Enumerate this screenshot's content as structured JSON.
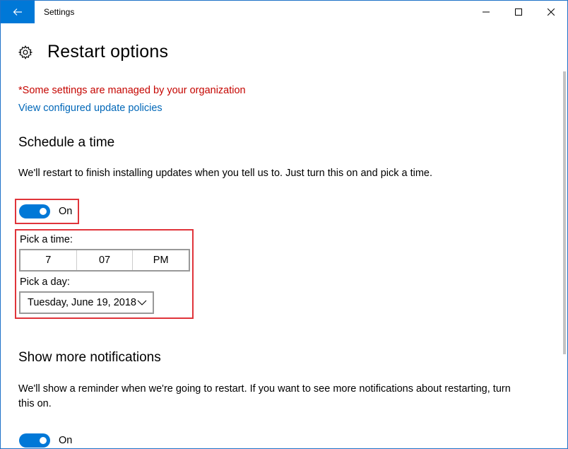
{
  "window": {
    "title": "Settings"
  },
  "page": {
    "title": "Restart options"
  },
  "notice": {
    "managed": "*Some settings are managed by your organization",
    "policies_link": "View configured update policies"
  },
  "schedule": {
    "heading": "Schedule a time",
    "description": "We'll restart to finish installing updates when you tell us to. Just turn this on and pick a time.",
    "toggle_label": "On",
    "toggle_on": true,
    "time_label": "Pick a time:",
    "time": {
      "hour": "7",
      "minute": "07",
      "period": "PM"
    },
    "day_label": "Pick a day:",
    "day_value": "Tuesday, June 19, 2018"
  },
  "notifications": {
    "heading": "Show more notifications",
    "description_line1": "We'll show a reminder when we're going to restart. If you want to see more notifications about restarting, turn",
    "description_line2": "this on.",
    "toggle_label": "On",
    "toggle_on": true
  },
  "colors": {
    "accent": "#0078d7",
    "warning": "#c50500",
    "link": "#0067b8",
    "highlight": "#e0343a"
  },
  "icons": {
    "back": "back-arrow-icon",
    "minimize": "minimize-icon",
    "maximize": "maximize-icon",
    "close": "close-icon",
    "gear": "gear-icon",
    "dropdown": "chevron-down-icon"
  }
}
